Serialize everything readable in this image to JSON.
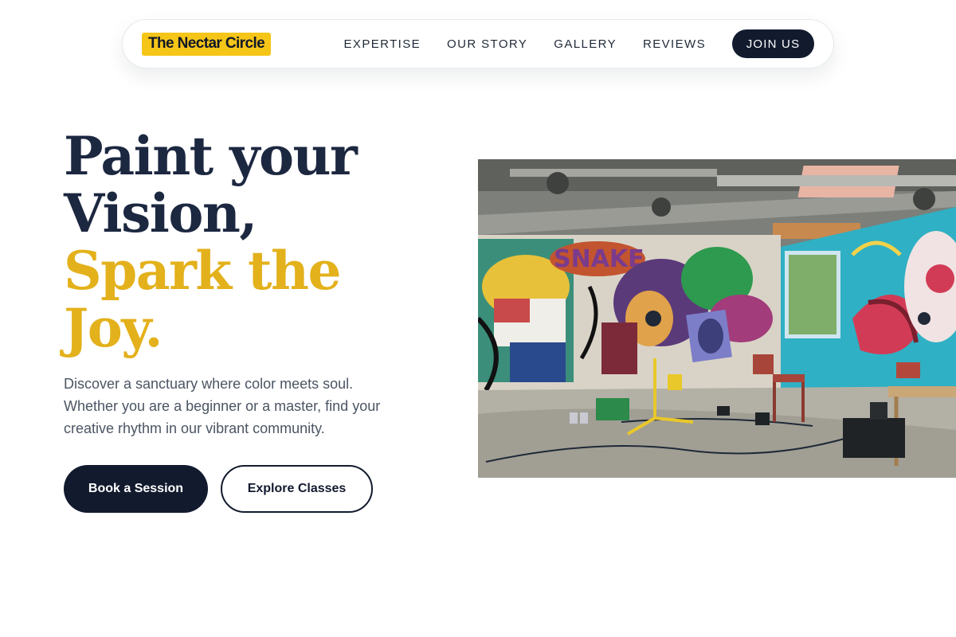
{
  "nav": {
    "logo": "The Nectar Circle",
    "links": [
      "EXPERTISE",
      "OUR STORY",
      "GALLERY",
      "REVIEWS"
    ],
    "cta": "JOIN US"
  },
  "hero": {
    "headline_line1": "Paint your",
    "headline_line2": "Vision,",
    "headline_accent_line1": "Spark the",
    "headline_accent_line2": "Joy.",
    "description": "Discover a sanctuary where color meets soul. Whether you are a beginner or a master, find your creative rhythm in our vibrant community.",
    "primary_button": "Book a Session",
    "secondary_button": "Explore Classes",
    "image": "graffiti-art-studio-photo"
  },
  "colors": {
    "brand_yellow": "#f5c518",
    "accent_gold": "#e3b11b",
    "navy": "#121a2e",
    "heading": "#1c2740",
    "body_text": "#4b5563"
  }
}
